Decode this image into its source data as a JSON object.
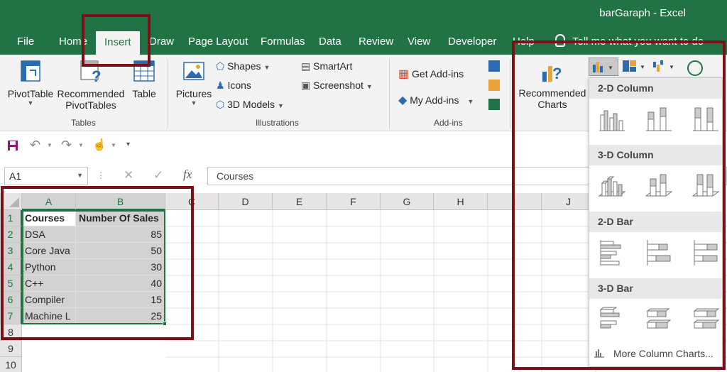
{
  "window": {
    "doc_title": "barGaraph - Excel"
  },
  "tabs": [
    "File",
    "Home",
    "Insert",
    "Draw",
    "Page Layout",
    "Formulas",
    "Data",
    "Review",
    "View",
    "Developer",
    "Help"
  ],
  "active_tab": "Insert",
  "tell_me": "Tell me what you want to do",
  "ribbon": {
    "tables": {
      "label": "Tables",
      "pivot": "PivotTable",
      "rec_pivot_1": "Recommended",
      "rec_pivot_2": "PivotTables",
      "table": "Table"
    },
    "illustrations": {
      "label": "Illustrations",
      "pictures": "Pictures",
      "shapes": "Shapes",
      "icons": "Icons",
      "models": "3D Models",
      "smartart": "SmartArt",
      "screenshot": "Screenshot"
    },
    "addins": {
      "label": "Add-ins",
      "get": "Get Add-ins",
      "my": "My Add-ins"
    },
    "charts": {
      "rec_1": "Recommended",
      "rec_2": "Charts"
    }
  },
  "formula_bar": {
    "name_box": "A1",
    "formula": "Courses",
    "fx": "fx"
  },
  "columns": [
    "A",
    "B",
    "C",
    "D",
    "E",
    "F",
    "G",
    "H",
    "I",
    "J"
  ],
  "rows": [
    "1",
    "2",
    "3",
    "4",
    "5",
    "6",
    "7",
    "8",
    "9",
    "10"
  ],
  "sheet": {
    "header": [
      "Courses",
      "Number Of Sales"
    ],
    "data": [
      [
        "DSA",
        "85"
      ],
      [
        "Core Java",
        "50"
      ],
      [
        "Python",
        "30"
      ],
      [
        "C++",
        "40"
      ],
      [
        "Compiler",
        "15"
      ],
      [
        "Machine L",
        "25"
      ]
    ]
  },
  "chart_dropdown": {
    "sections": [
      "2-D Column",
      "3-D Column",
      "2-D Bar",
      "3-D Bar"
    ],
    "more": "More Column Charts..."
  },
  "colors": {
    "excel_green": "#217346",
    "highlight": "#7b1018"
  }
}
